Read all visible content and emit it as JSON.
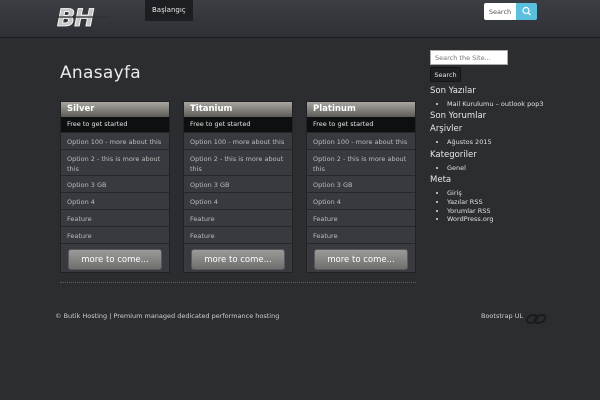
{
  "header": {
    "logo_text": "BH",
    "nav_home": "Başlangıç",
    "search_button": "Search",
    "search_icon": "search-icon"
  },
  "main": {
    "title": "Anasayfa",
    "plans": [
      {
        "name": "Silver",
        "tagline": "Free to get started",
        "features": [
          "Option 100 - more about this",
          "Option 2 - this is more about this",
          "Option 3 GB",
          "Option 4",
          "Feature",
          "Feature"
        ],
        "button": "more to come..."
      },
      {
        "name": "Titanium",
        "tagline": "Free to get started",
        "features": [
          "Option 100 - more about this",
          "Option 2 - this is more about this",
          "Option 3 GB",
          "Option 4",
          "Feature",
          "Feature"
        ],
        "button": "more to come..."
      },
      {
        "name": "Platinum",
        "tagline": "Free to get started",
        "features": [
          "Option 100 - more about this",
          "Option 2 - this is more about this",
          "Option 3 GB",
          "Option 4",
          "Feature",
          "Feature"
        ],
        "button": "more to come..."
      }
    ]
  },
  "sidebar": {
    "search_placeholder": "Search the Site...",
    "search_button": "Search",
    "recent_posts_title": "Son Yazılar",
    "recent_posts": [
      "Mail Kurulumu – outlook pop3"
    ],
    "recent_comments_title": "Son Yorumlar",
    "archives_title": "Arşivler",
    "archives": [
      "Ağustos 2015"
    ],
    "categories_title": "Kategoriler",
    "categories": [
      "Genel"
    ],
    "meta_title": "Meta",
    "meta": [
      "Giriş",
      "Yazılar RSS",
      "Yorumlar RSS",
      "WordPress.org"
    ]
  },
  "footer": {
    "copyright": "© Butik Hosting | Premium managed dedicated performance hosting",
    "credit": "Bootstrap UL"
  },
  "colors": {
    "background": "#2b2d31",
    "accent": "#5bc0de",
    "plan_header": "#8a8984"
  }
}
